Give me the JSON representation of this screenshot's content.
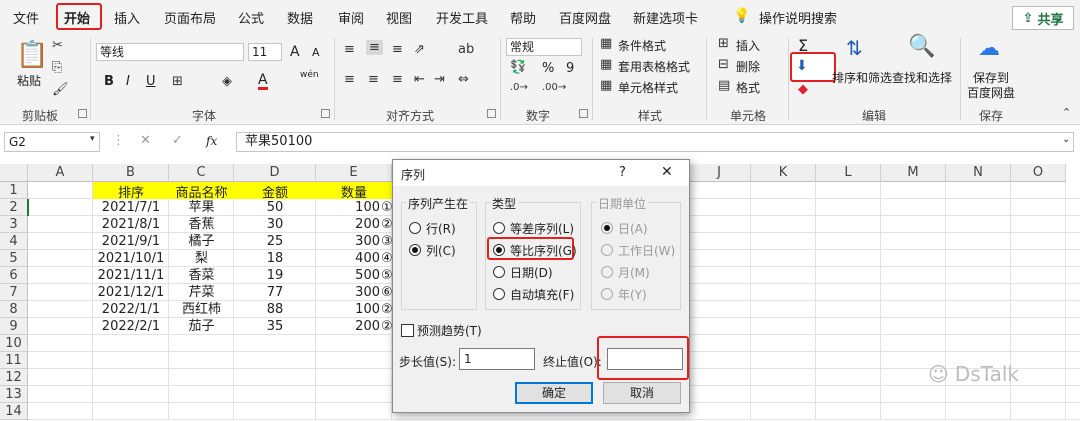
{
  "ribbon_tabs": [
    "文件",
    "开始",
    "插入",
    "页面布局",
    "公式",
    "数据",
    "审阅",
    "视图",
    "开发工具",
    "帮助",
    "百度网盘",
    "新建选项卡"
  ],
  "search_hint": "操作说明搜索",
  "share_label": "共享",
  "clipboard": {
    "paste": "粘贴",
    "group": "剪贴板"
  },
  "font": {
    "name": "等线",
    "size": "11",
    "bold": "B",
    "italic": "I",
    "underline": "U",
    "font_color_icon": "A",
    "group": "字体",
    "grow": "A",
    "shrink": "A",
    "wen": "wén"
  },
  "alignment": {
    "group": "对齐方式"
  },
  "number": {
    "format": "常规",
    "group": "数字",
    "percent": "%",
    "comma": "9"
  },
  "styles": {
    "conditional": "条件格式",
    "table": "套用表格格式",
    "cell": "单元格样式",
    "group": "样式"
  },
  "cells": {
    "insert": "插入",
    "delete": "删除",
    "format": "格式",
    "group": "单元格"
  },
  "editing": {
    "sum": "Σ",
    "sort_filter": "排序和筛选",
    "find_select": "查找和选择",
    "group": "编辑"
  },
  "save": {
    "label1": "保存到",
    "label2": "百度网盘",
    "group": "保存"
  },
  "formula_bar": {
    "namebox": "G2",
    "fx": "fx",
    "content": "苹果50100"
  },
  "columns": [
    "A",
    "B",
    "C",
    "D",
    "E",
    "J",
    "K",
    "L",
    "M",
    "N",
    "O"
  ],
  "rows": [
    "1",
    "2",
    "3",
    "4",
    "5",
    "6",
    "7",
    "8",
    "9",
    "10",
    "11",
    "12",
    "13",
    "14"
  ],
  "table": {
    "headers": [
      "排序",
      "商品名称",
      "金额",
      "数量"
    ],
    "data": [
      [
        "2021/7/1",
        "苹果",
        "50",
        "100",
        "①"
      ],
      [
        "2021/8/1",
        "香蕉",
        "30",
        "200",
        "②"
      ],
      [
        "2021/9/1",
        "橘子",
        "25",
        "300",
        "③"
      ],
      [
        "2021/10/1",
        "梨",
        "18",
        "400",
        "④"
      ],
      [
        "2021/11/1",
        "香菜",
        "19",
        "500",
        "⑤"
      ],
      [
        "2021/12/1",
        "芹菜",
        "77",
        "300",
        "⑥"
      ],
      [
        "2022/1/1",
        "西红柿",
        "88",
        "100",
        "②"
      ],
      [
        "2022/2/1",
        "茄子",
        "35",
        "200",
        "②"
      ]
    ]
  },
  "dialog": {
    "title": "序列",
    "help": "?",
    "close": "✕",
    "series_in": {
      "legend": "序列产生在",
      "row": "行(R)",
      "col": "列(C)"
    },
    "type": {
      "legend": "类型",
      "linear": "等差序列(L)",
      "growth": "等比序列(G)",
      "date": "日期(D)",
      "autofill": "自动填充(F)"
    },
    "date_unit": {
      "legend": "日期单位",
      "day": "日(A)",
      "weekday": "工作日(W)",
      "month": "月(M)",
      "year": "年(Y)"
    },
    "trend": "预测趋势(T)",
    "step_label": "步长值(S):",
    "step_value": "1",
    "stop_label": "终止值(O):",
    "stop_value": "",
    "ok": "确定",
    "cancel": "取消"
  },
  "watermark": "DsTalk",
  "colors": {
    "header_fill": "#ffff00",
    "accent": "#217346",
    "highlight": "#e32020"
  }
}
